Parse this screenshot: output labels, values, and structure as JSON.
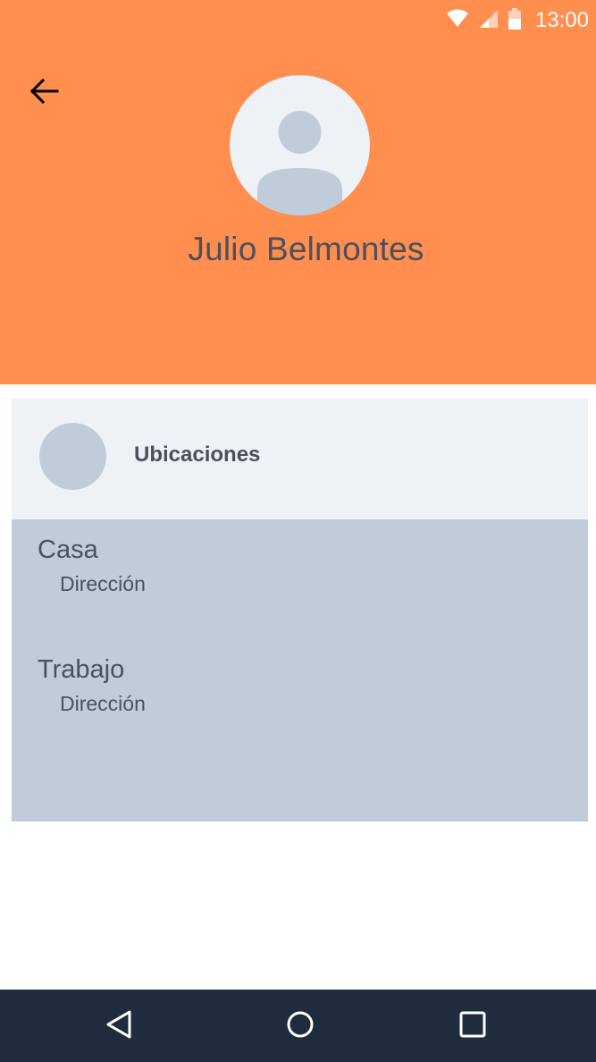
{
  "status_bar": {
    "time": "13:00",
    "icons": [
      "wifi-icon",
      "signal-icon",
      "battery-icon"
    ]
  },
  "header": {
    "back_icon": "arrow-left-icon",
    "profile_name": "Julio Belmontes"
  },
  "locations_card": {
    "title": "Ubicaciones",
    "items": [
      {
        "name": "Casa",
        "address": "Dirección"
      },
      {
        "name": "Trabajo",
        "address": "Dirección"
      }
    ]
  },
  "nav_bar": {
    "buttons": [
      "back-triangle-icon",
      "home-circle-icon",
      "recents-square-icon"
    ]
  },
  "colors": {
    "header_bg": "#ff8e4f",
    "card_head_bg": "#eef1f6",
    "card_body_bg": "#c1ccda",
    "text": "#4a5060",
    "nav_bg": "#1e2c3e"
  }
}
